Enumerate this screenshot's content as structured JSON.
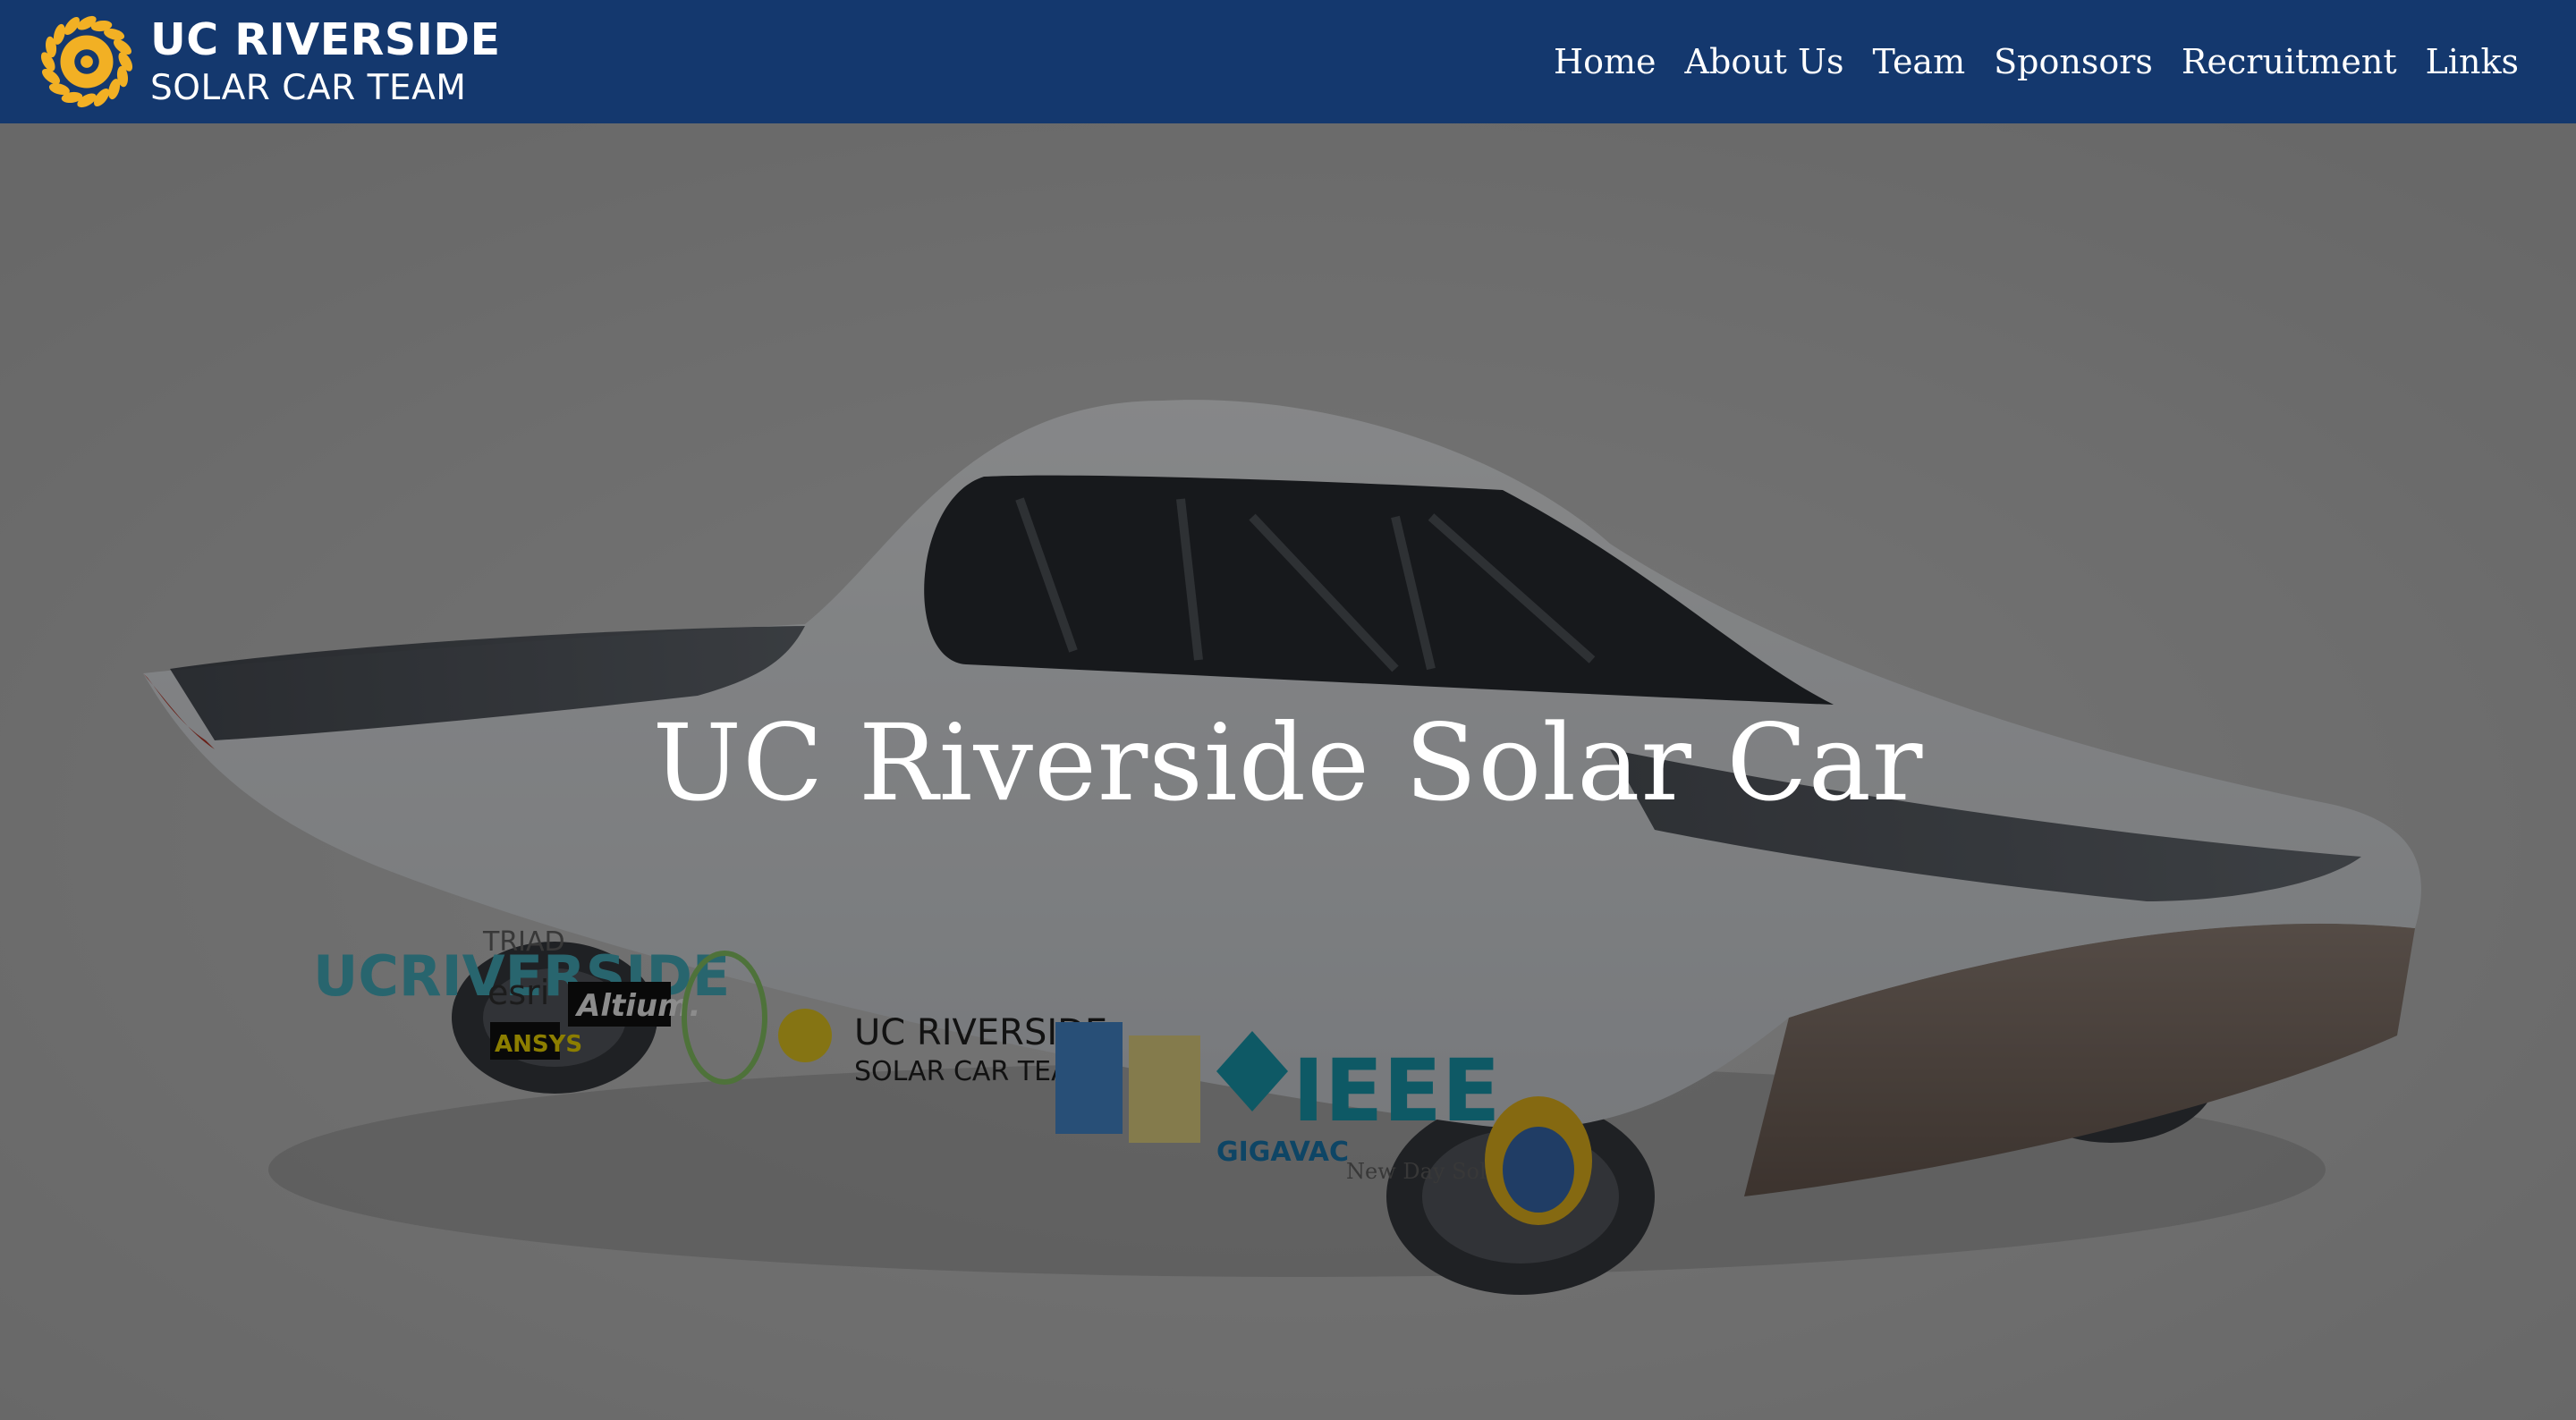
{
  "brand": {
    "title": "UC RIVERSIDE",
    "subtitle": "SOLAR CAR TEAM",
    "logo_icon": "sun-logo-icon",
    "logo_color": "#f2b024"
  },
  "nav": {
    "items": [
      {
        "label": "Home"
      },
      {
        "label": "About Us"
      },
      {
        "label": "Team"
      },
      {
        "label": "Sponsors"
      },
      {
        "label": "Recruitment"
      },
      {
        "label": "Links"
      }
    ],
    "background": "#14386e"
  },
  "hero": {
    "title": "UC Riverside Solar Car",
    "image": "solar-car-render-image",
    "car_decals": {
      "riverside": "UCRIVERSIDE",
      "triad": "TRIAD",
      "esri": "esri",
      "altium": "Altium.",
      "ansys": "ANSYS",
      "team_logo_line1": "UC RIVERSIDE",
      "team_logo_line2": "SOLAR CAR TEAM",
      "ieee": "IEEE",
      "gigavac": "GIGAVAC",
      "newday": "New Day Solar",
      "riverside_utilities": "RIVERSIDE"
    }
  }
}
